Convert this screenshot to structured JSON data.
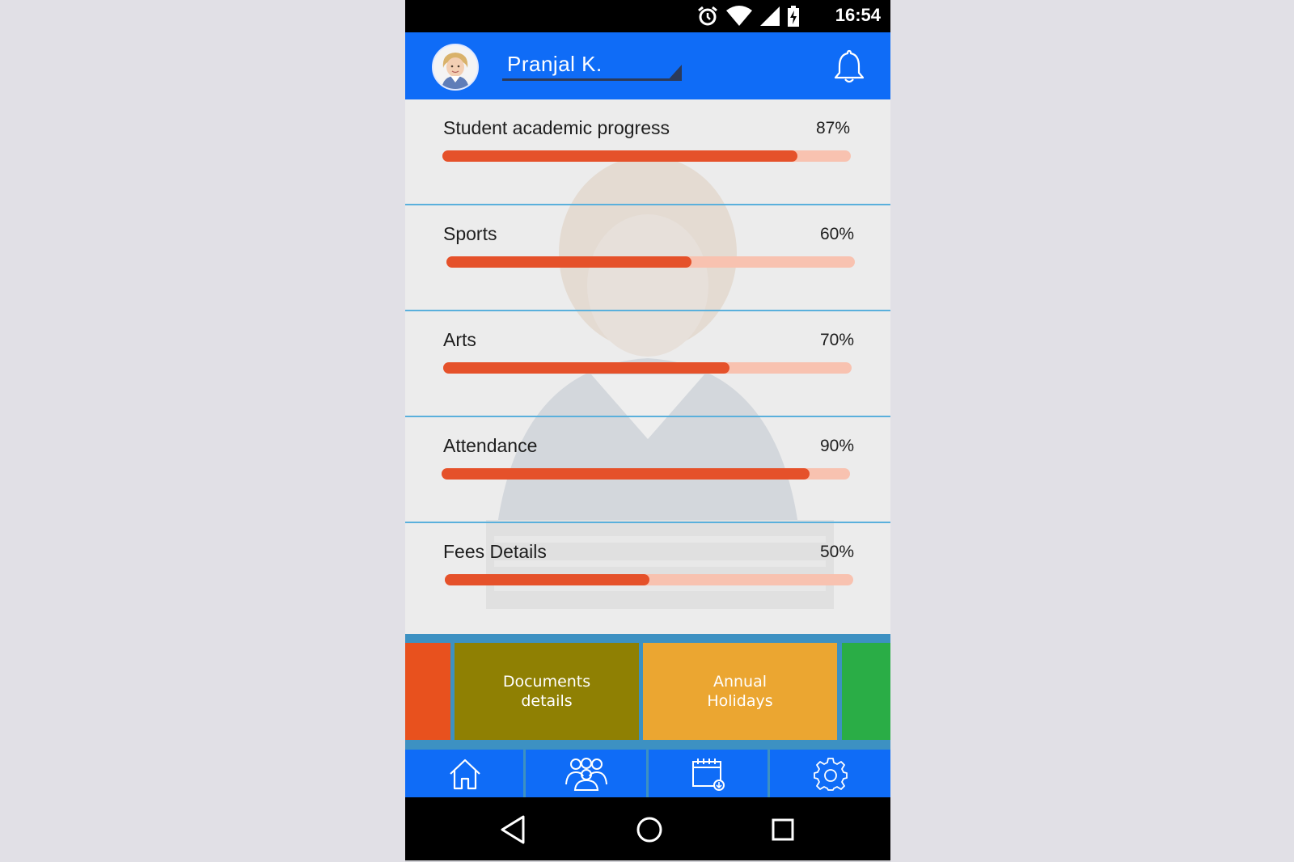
{
  "status_bar": {
    "time": "16:54",
    "icons": [
      "alarm-icon",
      "wifi-icon",
      "signal-icon",
      "battery-charging-icon"
    ]
  },
  "header": {
    "profile_name": "Pranjal  K.",
    "icons": [
      "avatar",
      "bell-icon"
    ]
  },
  "metrics": [
    {
      "label": "Student academic progress",
      "value_text": "87%",
      "value": 0.87
    },
    {
      "label": "Sports",
      "value_text": "60%",
      "value": 0.6
    },
    {
      "label": "Arts",
      "value_text": "70%",
      "value": 0.7
    },
    {
      "label": "Attendance",
      "value_text": "90%",
      "value": 0.9
    },
    {
      "label": "Fees Details",
      "value_text": "50%",
      "value": 0.5
    }
  ],
  "tiles": [
    {
      "label": "",
      "color": "#e8511e"
    },
    {
      "label_line1": "Documents",
      "label_line2": "details",
      "color": "#8f8003"
    },
    {
      "label_line1": "Annual",
      "label_line2": "Holidays",
      "color": "#eba631"
    },
    {
      "label": "",
      "color": "#2aad46"
    }
  ],
  "bottom_nav": {
    "items": [
      "home-icon",
      "people-icon",
      "calendar-download-icon",
      "settings-gear-icon"
    ]
  },
  "system_nav": {
    "items": [
      "back-icon",
      "home-circle-icon",
      "recents-icon"
    ]
  },
  "colors": {
    "primary": "#0f6cf7",
    "progress_fill": "#e5512a",
    "progress_track": "#f8c2b0",
    "divider": "#5ab0dc"
  }
}
